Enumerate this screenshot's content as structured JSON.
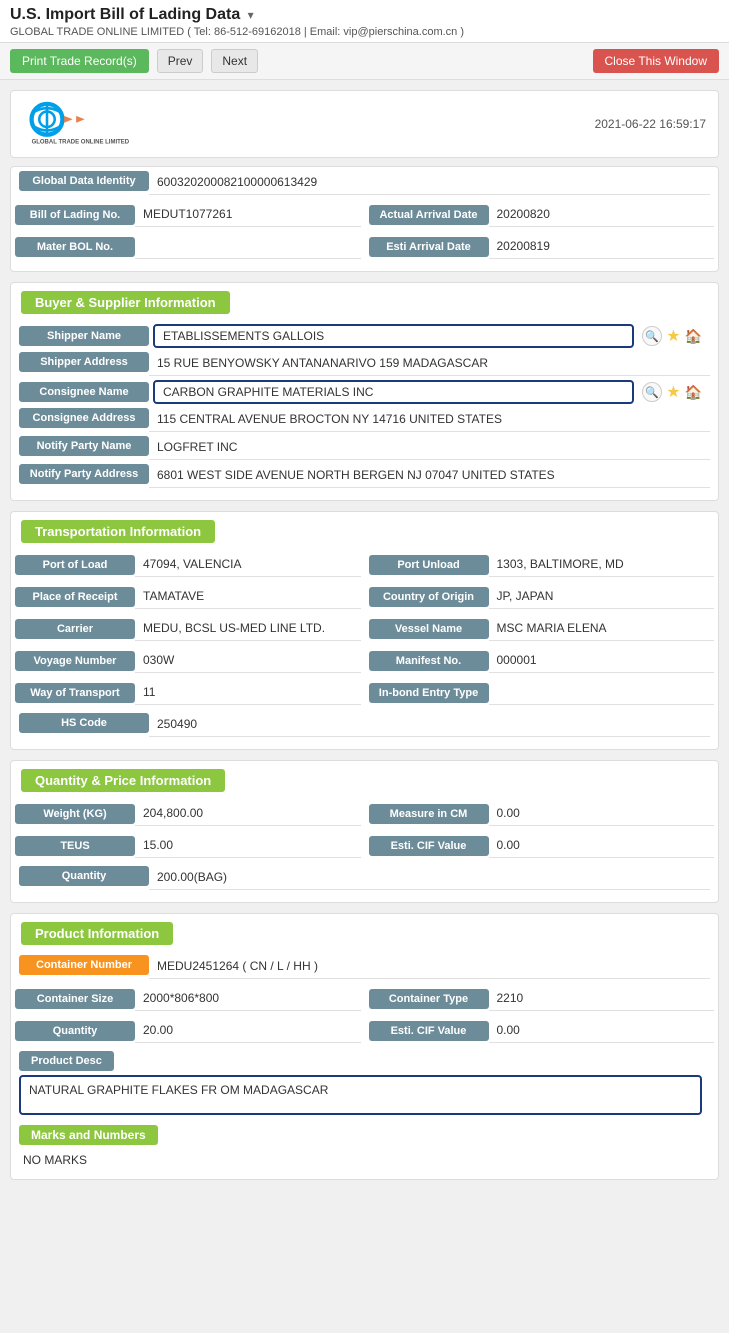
{
  "page": {
    "title": "U.S. Import Bill of Lading Data",
    "company": "GLOBAL TRADE ONLINE LIMITED ( Tel: 86-512-69162018 | Email: vip@pierschina.com.cn )",
    "datetime": "2021-06-22 16:59:17"
  },
  "toolbar": {
    "print_label": "Print Trade Record(s)",
    "prev_label": "Prev",
    "next_label": "Next",
    "close_label": "Close This Window"
  },
  "identity": {
    "global_data_identity_label": "Global Data Identity",
    "global_data_identity_value": "600320200082100000613429",
    "bill_of_lading_label": "Bill of Lading No.",
    "bill_of_lading_value": "MEDUT1077261",
    "actual_arrival_label": "Actual Arrival Date",
    "actual_arrival_value": "20200820",
    "mater_bol_label": "Mater BOL No.",
    "mater_bol_value": "",
    "esti_arrival_label": "Esti Arrival Date",
    "esti_arrival_value": "20200819"
  },
  "buyer_supplier": {
    "section_title": "Buyer & Supplier Information",
    "shipper_name_label": "Shipper Name",
    "shipper_name_value": "ETABLISSEMENTS GALLOIS",
    "shipper_address_label": "Shipper Address",
    "shipper_address_value": "15 RUE BENYOWSKY ANTANANARIVO 159 MADAGASCAR",
    "consignee_name_label": "Consignee Name",
    "consignee_name_value": "CARBON GRAPHITE MATERIALS INC",
    "consignee_address_label": "Consignee Address",
    "consignee_address_value": "115 CENTRAL AVENUE BROCTON NY 14716 UNITED STATES",
    "notify_party_name_label": "Notify Party Name",
    "notify_party_name_value": "LOGFRET INC",
    "notify_party_address_label": "Notify Party Address",
    "notify_party_address_value": "6801 WEST SIDE AVENUE NORTH BERGEN NJ 07047 UNITED STATES"
  },
  "transportation": {
    "section_title": "Transportation Information",
    "port_of_load_label": "Port of Load",
    "port_of_load_value": "47094, VALENCIA",
    "port_unload_label": "Port Unload",
    "port_unload_value": "1303, BALTIMORE, MD",
    "place_of_receipt_label": "Place of Receipt",
    "place_of_receipt_value": "TAMATAVE",
    "country_of_origin_label": "Country of Origin",
    "country_of_origin_value": "JP, JAPAN",
    "carrier_label": "Carrier",
    "carrier_value": "MEDU, BCSL US-MED LINE LTD.",
    "vessel_name_label": "Vessel Name",
    "vessel_name_value": "MSC MARIA ELENA",
    "voyage_number_label": "Voyage Number",
    "voyage_number_value": "030W",
    "manifest_no_label": "Manifest No.",
    "manifest_no_value": "000001",
    "way_of_transport_label": "Way of Transport",
    "way_of_transport_value": "11",
    "in_bond_entry_label": "In-bond Entry Type",
    "in_bond_entry_value": "",
    "hs_code_label": "HS Code",
    "hs_code_value": "250490"
  },
  "quantity_price": {
    "section_title": "Quantity & Price Information",
    "weight_label": "Weight (KG)",
    "weight_value": "204,800.00",
    "measure_label": "Measure in CM",
    "measure_value": "0.00",
    "teus_label": "TEUS",
    "teus_value": "15.00",
    "esti_cif_label": "Esti. CIF Value",
    "esti_cif_value": "0.00",
    "quantity_label": "Quantity",
    "quantity_value": "200.00(BAG)"
  },
  "product": {
    "section_title": "Product Information",
    "container_number_label": "Container Number",
    "container_number_value": "MEDU2451264 ( CN / L / HH )",
    "container_size_label": "Container Size",
    "container_size_value": "2000*806*800",
    "container_type_label": "Container Type",
    "container_type_value": "2210",
    "quantity_label": "Quantity",
    "quantity_value": "20.00",
    "esti_cif_label": "Esti. CIF Value",
    "esti_cif_value": "0.00",
    "product_desc_label": "Product Desc",
    "product_desc_value": "NATURAL GRAPHITE FLAKES FR OM MADAGASCAR",
    "marks_label": "Marks and Numbers",
    "marks_value": "NO MARKS"
  }
}
